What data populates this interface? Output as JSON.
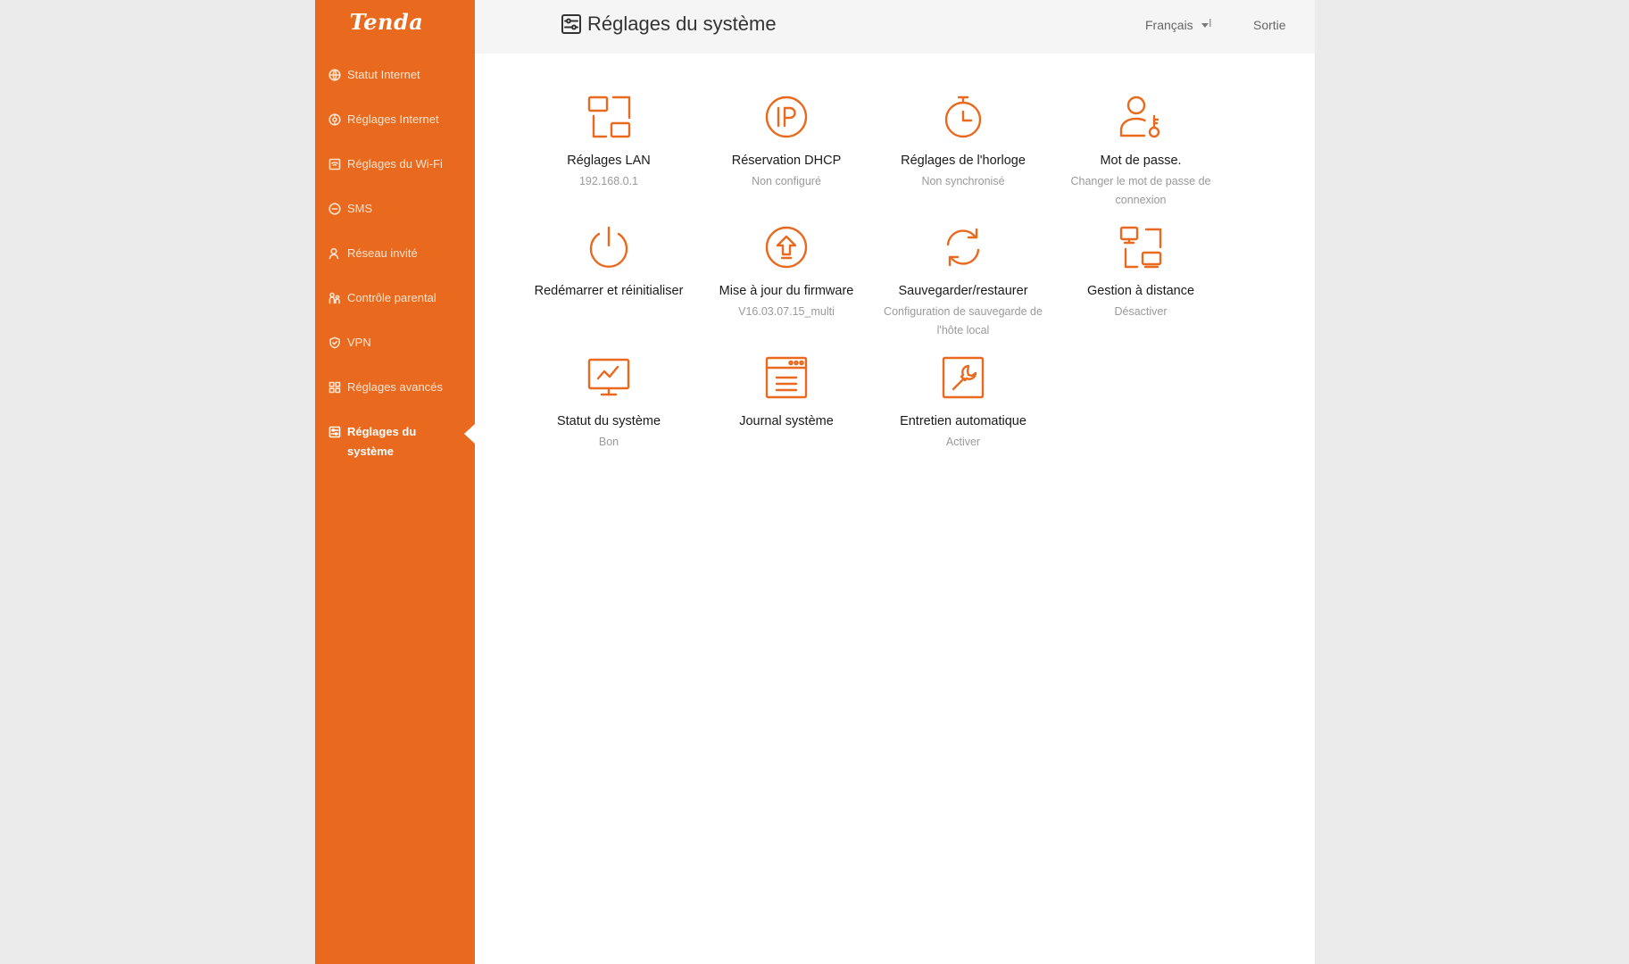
{
  "brand": {
    "logo": "Tenda"
  },
  "header": {
    "title": "Réglages du système",
    "language": "Français",
    "separator": "I",
    "logout": "Sortie"
  },
  "sidebar": {
    "items": [
      {
        "label": "Statut Internet",
        "icon": "globe-icon"
      },
      {
        "label": "Réglages Internet",
        "icon": "globe-gear-icon"
      },
      {
        "label": "Réglages du Wi-Fi",
        "icon": "wifi-icon"
      },
      {
        "label": "SMS",
        "icon": "sms-icon"
      },
      {
        "label": "Réseau invité",
        "icon": "guest-user-icon"
      },
      {
        "label": "Contrôle parental",
        "icon": "parental-icon"
      },
      {
        "label": "VPN",
        "icon": "vpn-shield-icon"
      },
      {
        "label": "Réglages avancés",
        "icon": "grid-icon"
      },
      {
        "label": "Réglages du système",
        "icon": "system-settings-icon",
        "active": true
      }
    ]
  },
  "tiles": [
    {
      "title": "Réglages LAN",
      "subtitle": "192.168.0.1",
      "icon": "lan-icon"
    },
    {
      "title": "Réservation DHCP",
      "subtitle": "Non configuré",
      "icon": "ip-icon"
    },
    {
      "title": "Réglages de l'horloge",
      "subtitle": "Non synchronisé",
      "icon": "stopwatch-icon"
    },
    {
      "title": "Mot de passe.",
      "subtitle": "Changer le mot de passe de connexion",
      "icon": "user-key-icon"
    },
    {
      "title": "Redémarrer et réinitialiser",
      "subtitle": "",
      "icon": "power-icon"
    },
    {
      "title": "Mise à jour du firmware",
      "subtitle": "V16.03.07.15_multi",
      "icon": "upgrade-icon"
    },
    {
      "title": "Sauvegarder/restaurer",
      "subtitle": "Configuration de sauvegarde de l'hôte local",
      "icon": "sync-icon"
    },
    {
      "title": "Gestion à distance",
      "subtitle": "Désactiver",
      "icon": "remote-management-icon"
    },
    {
      "title": "Statut du système",
      "subtitle": "Bon",
      "icon": "monitor-chart-icon"
    },
    {
      "title": "Journal système",
      "subtitle": "",
      "icon": "log-window-icon"
    },
    {
      "title": "Entretien automatique",
      "subtitle": "Activer",
      "icon": "wrench-icon"
    }
  ],
  "colors": {
    "accent": "#e96a1e",
    "sidebar_text": "#ffe3cf",
    "topbar": "#f5f5f5",
    "background": "#ebebeb"
  }
}
